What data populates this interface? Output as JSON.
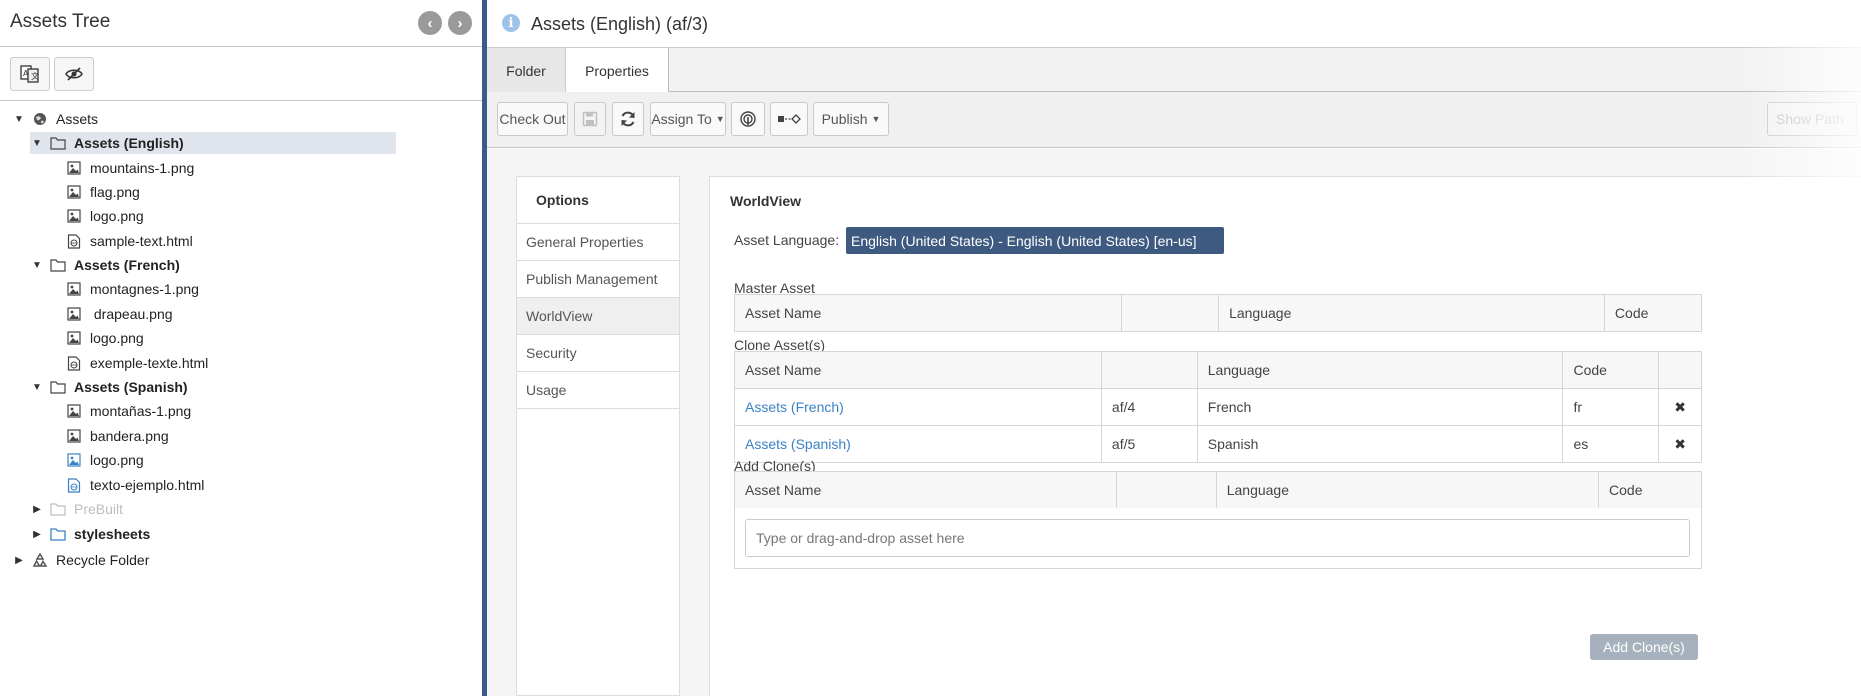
{
  "left_panel": {
    "title": "Assets Tree",
    "tree": [
      {
        "label": "Assets",
        "type": "globe",
        "expanded": true
      },
      {
        "label": "Assets (English)",
        "type": "folder",
        "expanded": true,
        "selected": true
      },
      {
        "label": "mountains-1.png",
        "type": "image"
      },
      {
        "label": "flag.png",
        "type": "image"
      },
      {
        "label": "logo.png",
        "type": "image"
      },
      {
        "label": "sample-text.html",
        "type": "html"
      },
      {
        "label": "Assets (French)",
        "type": "folder",
        "expanded": true
      },
      {
        "label": "montagnes-1.png",
        "type": "image"
      },
      {
        "label": " drapeau.png",
        "type": "image"
      },
      {
        "label": "logo.png",
        "type": "image"
      },
      {
        "label": "exemple-texte.html",
        "type": "html"
      },
      {
        "label": "Assets (Spanish)",
        "type": "folder",
        "expanded": true
      },
      {
        "label": "montañas-1.png",
        "type": "image"
      },
      {
        "label": "bandera.png",
        "type": "image"
      },
      {
        "label": "logo.png",
        "type": "image-blue"
      },
      {
        "label": "texto-ejemplo.html",
        "type": "html-blue"
      },
      {
        "label": "PreBuilt",
        "type": "folder",
        "expanded": false,
        "muted": true
      },
      {
        "label": "stylesheets",
        "type": "folder-blue",
        "expanded": false
      },
      {
        "label": "Recycle Folder",
        "type": "recycle",
        "expanded": false
      }
    ]
  },
  "main": {
    "title": "Assets (English) (af/3)",
    "tabs": [
      {
        "label": "Folder"
      },
      {
        "label": "Properties",
        "active": true
      }
    ],
    "toolbar": {
      "check_out": "Check Out",
      "assign_to": "Assign To",
      "publish": "Publish",
      "show_path": "Show Path"
    },
    "options": {
      "heading": "Options",
      "items": [
        "General Properties",
        "Publish Management",
        "WorldView",
        "Security",
        "Usage"
      ],
      "active": "WorldView"
    },
    "worldview": {
      "title": "WorldView",
      "asset_language_label": "Asset Language:",
      "asset_language_value": "English (United States) - English (United States) [en-us]",
      "master_asset_label": "Master Asset",
      "clone_assets_label": "Clone Asset(s)",
      "add_clones_label": "Add Clone(s)",
      "columns": {
        "asset_name": "Asset Name",
        "language": "Language",
        "code": "Code"
      },
      "clones": [
        {
          "name": "Assets (French)",
          "id": "af/4",
          "language": "French",
          "code": "fr"
        },
        {
          "name": "Assets (Spanish)",
          "id": "af/5",
          "language": "Spanish",
          "code": "es"
        }
      ],
      "add_placeholder": "Type or drag-and-drop asset here",
      "add_button": "Add Clone(s)"
    }
  },
  "colors": {
    "selection_bg": "#e0e4ec",
    "divider": "#3a5a8a",
    "language_badge": "#3f5a80",
    "link": "#3b82c4",
    "add_button": "#a7b1bd"
  }
}
